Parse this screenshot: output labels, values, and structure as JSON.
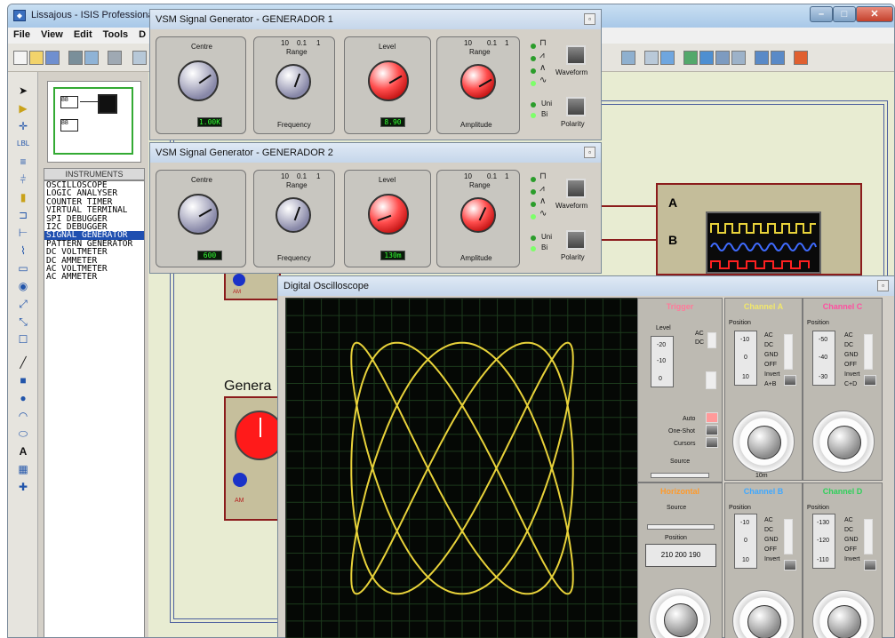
{
  "window": {
    "title": "Lissajous - ISIS Professional"
  },
  "menu": [
    "File",
    "View",
    "Edit",
    "Tools",
    "D"
  ],
  "instruments": {
    "header": "INSTRUMENTS",
    "items": [
      "OSCILLOSCOPE",
      "LOGIC ANALYSER",
      "COUNTER TIMER",
      "VIRTUAL TERMINAL",
      "SPI DEBUGGER",
      "I2C DEBUGGER",
      "SIGNAL GENERATOR",
      "PATTERN GENERATOR",
      "DC VOLTMETER",
      "DC AMMETER",
      "AC VOLTMETER",
      "AC AMMETER"
    ],
    "selected_index": 6
  },
  "generators": [
    {
      "title": "VSM Signal Generator - GENERADOR 1",
      "centre_display": "1.00K",
      "level_display": "8.90",
      "labels": {
        "centre": "Centre",
        "range": "Range",
        "level": "Level",
        "range2": "Range",
        "frequency": "Frequency",
        "amplitude": "Amplitude",
        "waveform": "Waveform",
        "polarity": "Polarity",
        "uni": "Uni",
        "bi": "Bi"
      },
      "scale_a": [
        "10",
        "0.1",
        "1"
      ],
      "scale_b": [
        "10",
        "0.1",
        "1"
      ]
    },
    {
      "title": "VSM Signal Generator - GENERADOR 2",
      "centre_display": "600",
      "level_display": "130m",
      "labels": {
        "centre": "Centre",
        "range": "Range",
        "level": "Level",
        "range2": "Range",
        "frequency": "Frequency",
        "amplitude": "Amplitude",
        "waveform": "Waveform",
        "polarity": "Polarity",
        "uni": "Uni",
        "bi": "Bi"
      },
      "scale_a": [
        "10",
        "0.1",
        "1"
      ],
      "scale_b": [
        "10",
        "0.1",
        "1"
      ]
    }
  ],
  "canvas": {
    "channel_a": "A",
    "channel_b": "B",
    "generator_label": "Genera",
    "am_label": "AM"
  },
  "oscilloscope": {
    "title": "Digital Oscilloscope",
    "trigger": {
      "title": "Trigger",
      "level": "Level",
      "ac": "AC",
      "dc": "DC",
      "auto": "Auto",
      "one_shot": "One-Shot",
      "cursors": "Cursors",
      "source": "Source",
      "ticks": [
        "-20",
        "-10",
        "0"
      ]
    },
    "channel_a": {
      "title": "Channel A",
      "position": "Position",
      "opts": [
        "AC",
        "DC",
        "GND",
        "OFF",
        "Invert",
        "A+B"
      ],
      "ticks": [
        "-10",
        "0",
        "10"
      ],
      "div": "10m"
    },
    "channel_c": {
      "title": "Channel C",
      "position": "Position",
      "opts": [
        "AC",
        "DC",
        "GND",
        "OFF",
        "Invert",
        "C+D"
      ],
      "ticks": [
        "-50",
        "-40",
        "-30"
      ]
    },
    "horizontal": {
      "title": "Horizontal",
      "source": "Source",
      "position": "Position",
      "values": [
        "210",
        "200",
        "190"
      ]
    },
    "channel_b": {
      "title": "Channel B",
      "position": "Position",
      "opts": [
        "AC",
        "DC",
        "GND",
        "OFF",
        "Invert"
      ],
      "ticks": [
        "-10",
        "0",
        "10"
      ]
    },
    "channel_d": {
      "title": "Channel D",
      "position": "Position",
      "opts": [
        "AC",
        "DC",
        "GND",
        "OFF",
        "Invert"
      ],
      "ticks": [
        "-130",
        "-120",
        "-110"
      ]
    }
  },
  "colors": {
    "trace": "#e8d23a",
    "trigger_title": "#ff7a9a",
    "channel_a": "#f2e86a",
    "channel_c": "#ff4fa0",
    "horizontal": "#ff9a2a",
    "channel_b": "#3fa8ff",
    "channel_d": "#2fd05a"
  }
}
